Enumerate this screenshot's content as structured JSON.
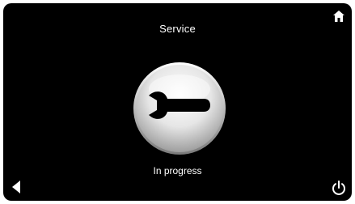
{
  "screen": {
    "title": "Service",
    "status": "In progress"
  },
  "icons": {
    "home": "home-icon",
    "back": "back-arrow-icon",
    "power": "power-icon",
    "service": "wrench-icon"
  },
  "colors": {
    "background": "#000000",
    "foreground": "#ffffff"
  }
}
